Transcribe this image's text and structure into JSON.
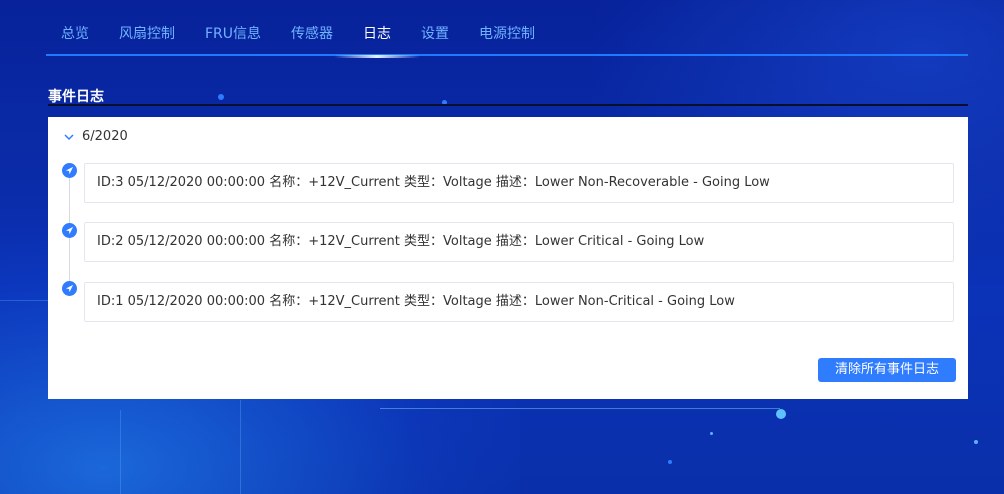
{
  "nav": {
    "items": [
      {
        "label": "总览"
      },
      {
        "label": "风扇控制"
      },
      {
        "label": "FRU信息"
      },
      {
        "label": "传感器"
      },
      {
        "label": "日志"
      },
      {
        "label": "设置"
      },
      {
        "label": "电源控制"
      }
    ],
    "active": "日志"
  },
  "section": {
    "title": "事件日志"
  },
  "log_group": {
    "label": "6/2020",
    "expanded": true,
    "entries": [
      {
        "text": "ID:3 05/12/2020 00:00:00 名称：+12V_Current 类型：Voltage 描述：Lower Non-Recoverable - Going Low"
      },
      {
        "text": "ID:2 05/12/2020 00:00:00 名称：+12V_Current 类型：Voltage 描述：Lower Critical - Going Low"
      },
      {
        "text": "ID:1 05/12/2020 00:00:00 名称：+12V_Current 类型：Voltage 描述：Lower Non-Critical - Going Low"
      }
    ]
  },
  "actions": {
    "clear_label": "清除所有事件日志"
  },
  "colors": {
    "accent": "#2f7cff",
    "nav_text": "#6fb2ff",
    "background": "#0a2ba8"
  }
}
